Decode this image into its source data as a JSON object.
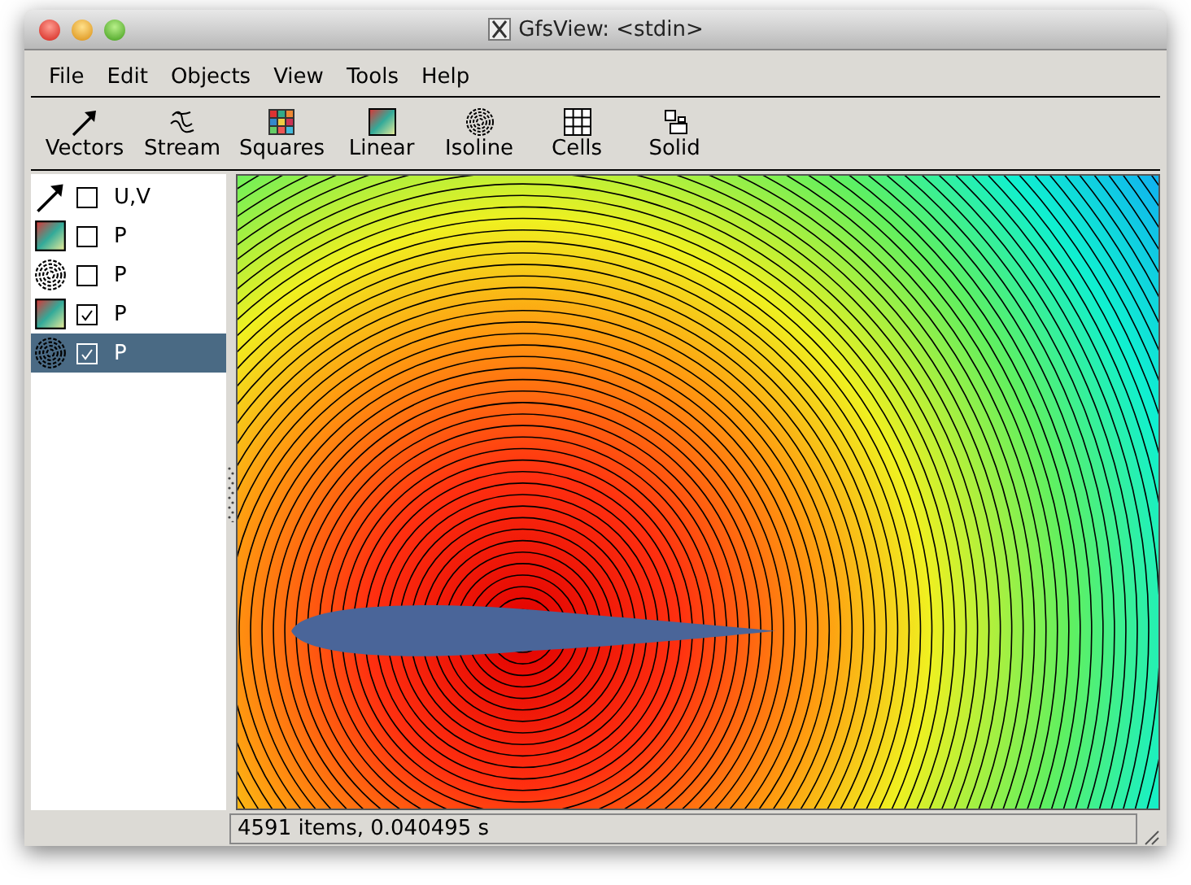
{
  "window": {
    "title": "GfsView: <stdin>"
  },
  "menu": [
    "File",
    "Edit",
    "Objects",
    "View",
    "Tools",
    "Help"
  ],
  "toolbar": [
    {
      "label": "Vectors",
      "kind": "vectors"
    },
    {
      "label": "Stream",
      "kind": "stream"
    },
    {
      "label": "Squares",
      "kind": "squares"
    },
    {
      "label": "Linear",
      "kind": "linear"
    },
    {
      "label": "Isoline",
      "kind": "isoline"
    },
    {
      "label": "Cells",
      "kind": "cells"
    },
    {
      "label": "Solid",
      "kind": "solid"
    }
  ],
  "layers": [
    {
      "kind": "vectors",
      "label": "U,V",
      "checked": false,
      "selected": false
    },
    {
      "kind": "linear",
      "label": "P",
      "checked": false,
      "selected": false
    },
    {
      "kind": "isoline",
      "label": "P",
      "checked": false,
      "selected": false
    },
    {
      "kind": "linear",
      "label": "P",
      "checked": true,
      "selected": false
    },
    {
      "kind": "isoline",
      "label": "P",
      "checked": true,
      "selected": true
    }
  ],
  "status_bar": "4591 items, 0.040495 s"
}
